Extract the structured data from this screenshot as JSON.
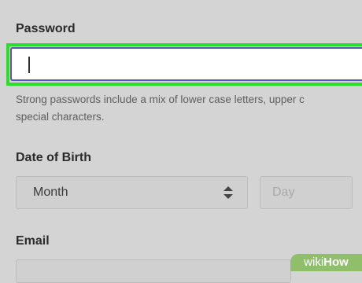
{
  "form": {
    "password": {
      "label": "Password",
      "value": "",
      "hint_line1": "Strong passwords include a mix of lower case letters, upper c",
      "hint_line2": "special characters."
    },
    "date_of_birth": {
      "label": "Date of Birth",
      "month_selected": "Month",
      "day_placeholder": "Day"
    },
    "email": {
      "label": "Email",
      "value": ""
    }
  },
  "watermark": {
    "part1": "wiki",
    "part2": "How"
  },
  "colors": {
    "highlight": "#27e027",
    "input_border": "#5a57b5",
    "watermark_bg": "#8fbf6b"
  },
  "icons": {
    "month_dropdown": "chevron-up-down-icon"
  }
}
